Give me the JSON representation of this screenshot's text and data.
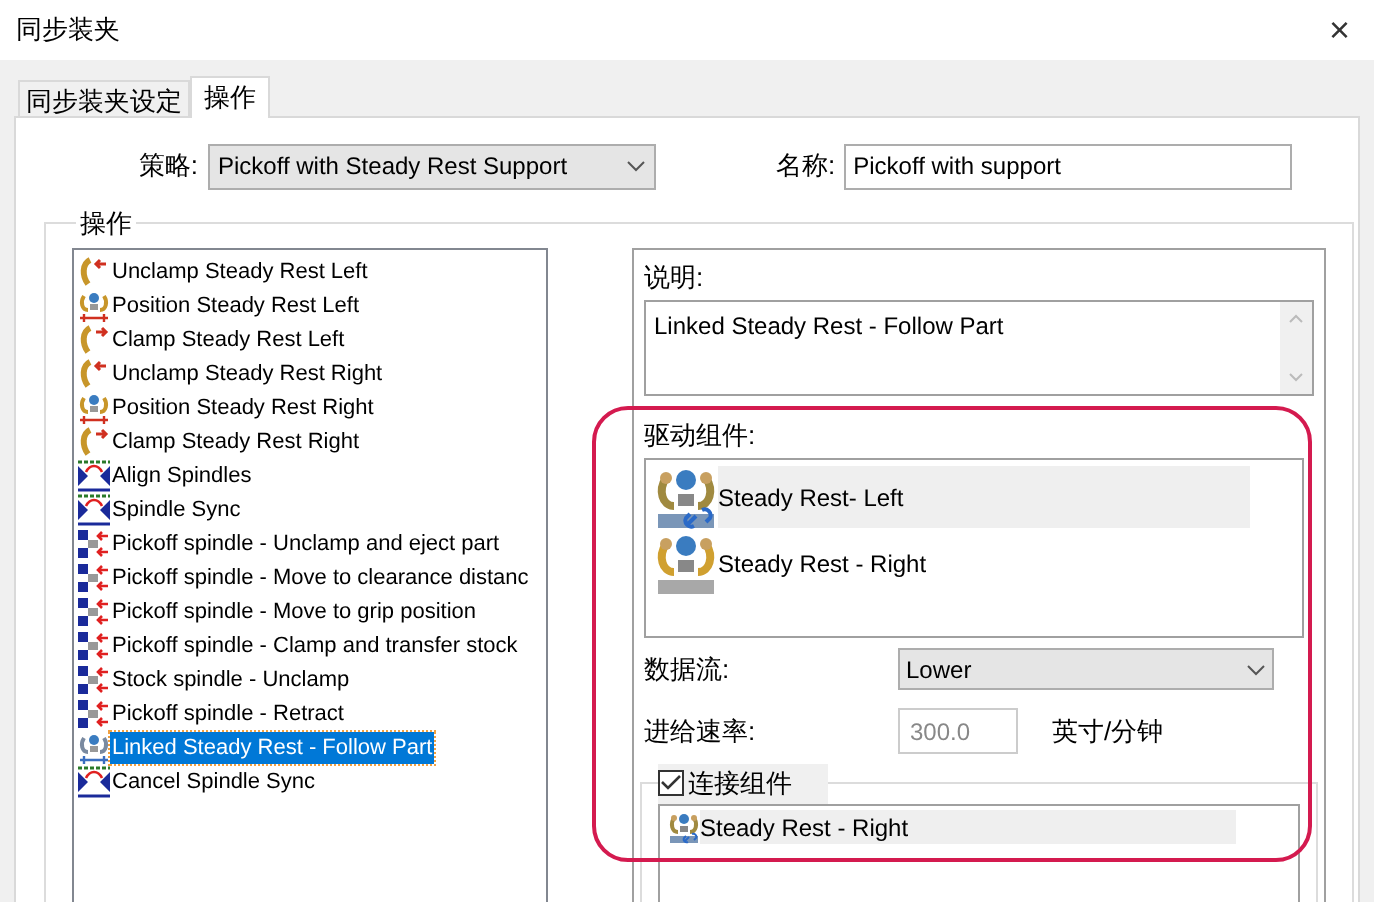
{
  "window": {
    "title": "同步装夹",
    "close": "×"
  },
  "tabs": [
    {
      "label": "同步装夹设定",
      "selected": false
    },
    {
      "label": "操作",
      "selected": true
    }
  ],
  "strategy": {
    "label": "策略:",
    "value": "Pickoff with Steady Rest Support"
  },
  "name": {
    "label": "名称:",
    "value": "Pickoff with support"
  },
  "operations": {
    "title": "操作",
    "items": [
      {
        "label": "Unclamp Steady Rest Left",
        "kind": "unclamp-rest",
        "selected": false
      },
      {
        "label": "Position Steady Rest Left",
        "kind": "position-rest",
        "selected": false
      },
      {
        "label": "Clamp Steady Rest Left",
        "kind": "clamp-rest",
        "selected": false
      },
      {
        "label": "Unclamp Steady Rest Right",
        "kind": "unclamp-rest",
        "selected": false
      },
      {
        "label": "Position Steady Rest Right",
        "kind": "position-rest",
        "selected": false
      },
      {
        "label": "Clamp Steady Rest Right",
        "kind": "clamp-rest",
        "selected": false
      },
      {
        "label": "Align Spindles",
        "kind": "spindle-sync",
        "selected": false
      },
      {
        "label": "Spindle Sync",
        "kind": "spindle-sync",
        "selected": false
      },
      {
        "label": "Pickoff spindle - Unclamp and eject part",
        "kind": "pickoff",
        "selected": false
      },
      {
        "label": "Pickoff spindle - Move to clearance distanc",
        "kind": "pickoff",
        "selected": false
      },
      {
        "label": "Pickoff spindle - Move to grip position",
        "kind": "pickoff",
        "selected": false
      },
      {
        "label": "Pickoff spindle - Clamp and transfer stock",
        "kind": "pickoff",
        "selected": false
      },
      {
        "label": "Stock spindle - Unclamp",
        "kind": "pickoff",
        "selected": false
      },
      {
        "label": "Pickoff spindle - Retract",
        "kind": "pickoff",
        "selected": false
      },
      {
        "label": "Linked Steady Rest - Follow Part",
        "kind": "linked-rest",
        "selected": true
      },
      {
        "label": "Cancel Spindle Sync",
        "kind": "spindle-sync",
        "selected": false
      }
    ]
  },
  "description": {
    "label": "说明:",
    "value": "Linked Steady Rest - Follow Part"
  },
  "drive_components": {
    "label": "驱动组件:",
    "items": [
      {
        "label": "Steady Rest- Left",
        "kind": "linked",
        "selected": true
      },
      {
        "label": "Steady Rest - Right",
        "kind": "plain",
        "selected": false
      }
    ]
  },
  "data_flow": {
    "label": "数据流:",
    "value": "Lower"
  },
  "feed_rate": {
    "label": "进给速率:",
    "value": "300.0",
    "unit": "英寸/分钟",
    "disabled": true
  },
  "connect_components": {
    "label": "连接组件",
    "checked": true,
    "items": [
      {
        "label": "Steady Rest - Right",
        "selected": true
      }
    ]
  }
}
